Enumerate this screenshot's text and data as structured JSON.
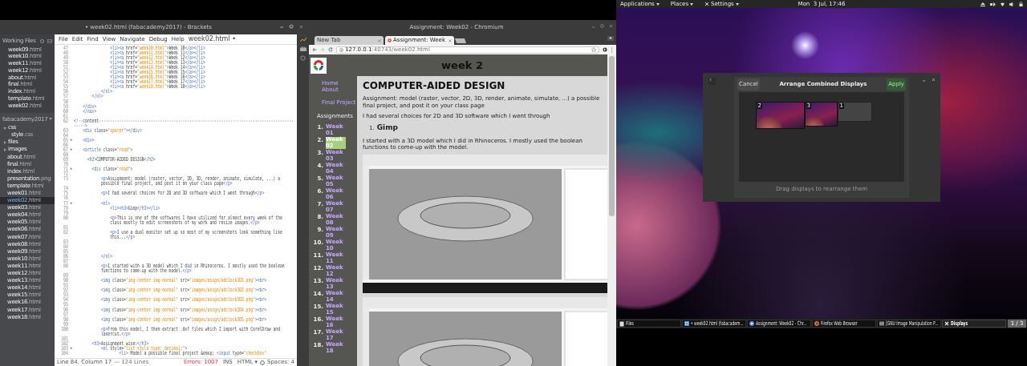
{
  "brackets": {
    "title": "• week02.html (fabacademy2017) - Brackets",
    "sidebar": {
      "working_files_title": "Working Files",
      "working_files": [
        {
          "name": "week09",
          "ext": ".html",
          "selected": false
        },
        {
          "name": "week10",
          "ext": ".html",
          "selected": false
        },
        {
          "name": "week11",
          "ext": ".html",
          "selected": false
        },
        {
          "name": "week12",
          "ext": ".html",
          "selected": false
        },
        {
          "name": "about",
          "ext": ".html",
          "selected": false
        },
        {
          "name": "final",
          "ext": ".html",
          "selected": false
        },
        {
          "name": "index",
          "ext": ".html",
          "selected": false
        },
        {
          "name": "template",
          "ext": ".html",
          "selected": false
        },
        {
          "name": "week02",
          "ext": ".html",
          "selected": false
        }
      ],
      "project": "fabacademy2017",
      "tree": [
        {
          "kind": "folder",
          "name": "css",
          "expanded": true,
          "selected": false,
          "children": [
            {
              "kind": "file",
              "name": "style",
              "ext": ".css",
              "selected": false
            }
          ]
        },
        {
          "kind": "folder",
          "name": "files",
          "expanded": false,
          "selected": false
        },
        {
          "kind": "folder",
          "name": "images",
          "expanded": false,
          "selected": false
        },
        {
          "kind": "file",
          "name": "about",
          "ext": ".html",
          "selected": false
        },
        {
          "kind": "file",
          "name": "final",
          "ext": ".html",
          "selected": false
        },
        {
          "kind": "file",
          "name": "index",
          "ext": ".html",
          "selected": false
        },
        {
          "kind": "file",
          "name": "presentation",
          "ext": ".png",
          "selected": false
        },
        {
          "kind": "file",
          "name": "template",
          "ext": ".html",
          "selected": false
        },
        {
          "kind": "file",
          "name": "week01",
          "ext": ".html",
          "selected": false
        },
        {
          "kind": "file",
          "name": "week02",
          "ext": ".html",
          "selected": true
        },
        {
          "kind": "file",
          "name": "week03",
          "ext": ".html",
          "selected": false
        },
        {
          "kind": "file",
          "name": "week04",
          "ext": ".html",
          "selected": false
        },
        {
          "kind": "file",
          "name": "week05",
          "ext": ".html",
          "selected": false
        },
        {
          "kind": "file",
          "name": "week06",
          "ext": ".html",
          "selected": false
        },
        {
          "kind": "file",
          "name": "week07",
          "ext": ".html",
          "selected": false
        },
        {
          "kind": "file",
          "name": "week08",
          "ext": ".html",
          "selected": false
        },
        {
          "kind": "file",
          "name": "week09",
          "ext": ".html",
          "selected": false
        },
        {
          "kind": "file",
          "name": "week10",
          "ext": ".html",
          "selected": false
        },
        {
          "kind": "file",
          "name": "week11",
          "ext": ".html",
          "selected": false
        },
        {
          "kind": "file",
          "name": "week12",
          "ext": ".html",
          "selected": false
        },
        {
          "kind": "file",
          "name": "week13",
          "ext": ".html",
          "selected": false
        },
        {
          "kind": "file",
          "name": "week14",
          "ext": ".html",
          "selected": false
        },
        {
          "kind": "file",
          "name": "week15",
          "ext": ".html",
          "selected": false
        },
        {
          "kind": "file",
          "name": "week16",
          "ext": ".html",
          "selected": false
        },
        {
          "kind": "file",
          "name": "week17",
          "ext": ".html",
          "selected": false
        },
        {
          "kind": "file",
          "name": "week18",
          "ext": ".html",
          "selected": false
        }
      ]
    },
    "menu": [
      "File",
      "Edit",
      "Find",
      "View",
      "Navigate",
      "Debug",
      "Help"
    ],
    "file_title": "week02.html •",
    "code": [
      {
        "num": "47",
        "text": "                <li><a href=\"week10.html\">Week 10</a></li>"
      },
      {
        "num": "48",
        "text": "                <li><a href=\"week11.html\">Week 11</a></li>"
      },
      {
        "num": "49",
        "text": "                <li><a href=\"week12.html\">Week 12</a></li>"
      },
      {
        "num": "50",
        "text": "                <li><a href=\"week13.html\">Week 13</a></li>"
      },
      {
        "num": "51",
        "text": "                <li><a href=\"week14.html\">Week 14</a></li>"
      },
      {
        "num": "52",
        "text": "                <li><a href=\"week15.html\">Week 15</a></li>"
      },
      {
        "num": "53",
        "text": "                <li><a href=\"week16.html\">Week 16</a></li>"
      },
      {
        "num": "54",
        "text": "                <li><a href=\"week17.html\">Week 17</a></li>"
      },
      {
        "num": "55",
        "text": "                <li><a href=\"week18.html\">Week 18</a></li>"
      },
      {
        "num": "56",
        "text": "            </ol>"
      },
      {
        "num": "57",
        "text": "        </ol>"
      },
      {
        "num": "58"
      },
      {
        "num": "59",
        "text": "    </div>"
      },
      {
        "num": "60",
        "text": "    </nav>"
      },
      {
        "num": "61"
      },
      {
        "num": "62",
        "text": "<!--content--------------------------------------------------------------------------------------",
        "cont": "----->"
      },
      {
        "num": "63",
        "text": "    <div class=\"spacer\"></div>"
      },
      {
        "num": "64"
      },
      {
        "num": "65",
        "text": "    <div>",
        "marker": "▾"
      },
      {
        "num": "66"
      },
      {
        "num": "67",
        "text": "    <article class=\"read\">",
        "marker": "▾"
      },
      {
        "num": "68"
      },
      {
        "num": "69",
        "text": "      <h2>COMPUTER-AIDED DESIGN</h2>"
      },
      {
        "num": "70"
      },
      {
        "num": "71",
        "text": "        <div class=\"read\">",
        "marker": "▾"
      },
      {
        "num": "72"
      },
      {
        "num": "73",
        "text": "            <p>Assignment: model (raster, vector, 2D, 3D, render, animate, simulate, ...) a",
        "cont": "            possible final project, and post it on your class page</p>"
      },
      {
        "num": "74"
      },
      {
        "num": "75",
        "text": "            <p>I had several choices for 2D and 3D software which I went through</p>"
      },
      {
        "num": "76"
      },
      {
        "num": "77",
        "text": "            <ol>",
        "marker": "▾"
      },
      {
        "num": "78",
        "text": "                <li><h3>Gimp</h3></li>"
      },
      {
        "num": "79"
      },
      {
        "num": "80",
        "text": "                <p>This is one of the softwares I have utilized for almost every week of the",
        "cont": "                class mostly to edit screenshots of my work and resize images.</p>"
      },
      {
        "num": "81"
      },
      {
        "num": "82",
        "text": "                <p>I use a dual monitor set up so most of my screenshots look something like",
        "cont": "                this...</p>"
      },
      {
        "num": "83"
      },
      {
        "num": "84"
      },
      {
        "num": "85"
      },
      {
        "num": "86",
        "text": "            </ol>"
      },
      {
        "num": "87"
      },
      {
        "num": "88",
        "text": "            <p>I started with a 3D model which I did in Rhinoceros. I mostly used the boolean",
        "cont": "            functions to come-up with the model.</p>"
      },
      {
        "num": "89"
      },
      {
        "num": "90",
        "text": "            <img class=\"img-center img-normal\" src=\"images/assgn/adclock3D1.png\"><br>"
      },
      {
        "num": "91"
      },
      {
        "num": "92",
        "text": "            <img class=\"img-center img-normal\" src=\"images/assgn/adclock3D2.png\"><br>"
      },
      {
        "num": "93"
      },
      {
        "num": "94",
        "text": "            <img class=\"img-center img-normal\" src=\"images/assgn/adclock3D3.png\"><br>"
      },
      {
        "num": "95"
      },
      {
        "num": "96",
        "text": "            <img class=\"img-center img-normal\" src=\"images/assgn/adclock3D4.png\"><br>"
      },
      {
        "num": "97"
      },
      {
        "num": "98",
        "text": "            <img class=\"img-center img-normal\" src=\"images/assgn/adclock3D5.png\"><br>"
      },
      {
        "num": "99"
      },
      {
        "num": "100",
        "text": "            <p>From this model, I then extract .dxf files which I import with CorelDraw and",
        "cont": "            lasercut.</p>"
      },
      {
        "num": "101"
      },
      {
        "num": "102",
        "text": "        <h3>Assignment wise:</h3>"
      },
      {
        "num": "103",
        "text": "            <ol style=\"list-style-type: decimal;\">",
        "marker": "▾"
      },
      {
        "num": "104",
        "text": "                    <li> Model a possible final project &emsp; <input type=\"checkbox\""
      }
    ],
    "status": {
      "position": "Line 84, Column 17",
      "line_count": "— 124 Lines",
      "errors": "Errors: 1007",
      "mode": "INS",
      "language": "HTML ▾",
      "indent": "Spaces: 4"
    }
  },
  "chromium": {
    "title": "Assignment: Week02 - Chromium",
    "tabs": [
      {
        "label": "New Tab",
        "selected": false
      },
      {
        "label": "Assignment: Week",
        "selected": true
      }
    ],
    "url_host": "127.0.0.1",
    "url_rest": ":40743/week02.html",
    "page": {
      "heading": "week 2",
      "nav_links": [
        "Home",
        "About",
        "Final Project"
      ],
      "assignments_label": "Assignments",
      "weeks": [
        {
          "number": "1.",
          "label": "Week 01",
          "selected": false
        },
        {
          "number": "2.",
          "label": "Week 02",
          "selected": true
        },
        {
          "number": "3.",
          "label": "Week 03",
          "selected": false
        },
        {
          "number": "4.",
          "label": "Week 04",
          "selected": false
        },
        {
          "number": "5.",
          "label": "Week 05",
          "selected": false
        },
        {
          "number": "6.",
          "label": "Week 06",
          "selected": false
        },
        {
          "number": "7.",
          "label": "Week 07",
          "selected": false
        },
        {
          "number": "8.",
          "label": "Week 08",
          "selected": false
        },
        {
          "number": "9.",
          "label": "Week 09",
          "selected": false
        },
        {
          "number": "10.",
          "label": "Week 10",
          "selected": false
        },
        {
          "number": "11.",
          "label": "Week 11",
          "selected": false
        },
        {
          "number": "12.",
          "label": "Week 12",
          "selected": false
        },
        {
          "number": "13.",
          "label": "Week 13",
          "selected": false
        },
        {
          "number": "14.",
          "label": "Week 14",
          "selected": false
        },
        {
          "number": "15.",
          "label": "Week 15",
          "selected": false
        },
        {
          "number": "16.",
          "label": "Week 16",
          "selected": false
        },
        {
          "number": "17.",
          "label": "Week 17",
          "selected": false
        },
        {
          "number": "18.",
          "label": "Week 18",
          "selected": false
        }
      ],
      "title": "COMPUTER-AIDED DESIGN",
      "blocks": [
        {
          "kind": "paragraph",
          "text": "Assignment: model (raster, vector, 2D, 3D, render, animate, simulate, ...) a possible final project, and post it on your class page"
        },
        {
          "kind": "paragraph",
          "text": "I had several choices for 2D and 3D software which I went through"
        },
        {
          "kind": "list-heading",
          "number": "1.",
          "text": "Gimp"
        },
        {
          "kind": "paragraph",
          "text": "I started with a 3D model which I did in Rhinoceros. I mostly used the boolean functions to come-up with the model."
        },
        {
          "kind": "image"
        },
        {
          "kind": "image"
        }
      ]
    }
  },
  "desktop": {
    "top_bar": {
      "menus": [
        "Applications",
        "Places",
        "Settings"
      ],
      "clock": "Mon  3 Jul, 17:46"
    },
    "dialog": {
      "cancel": "Cancel",
      "title": "Arrange Combined Displays",
      "apply": "Apply",
      "apply_disabled": true,
      "monitors": [
        {
          "label": "2",
          "kind": "wallpaper"
        },
        {
          "label": "3",
          "kind": "wallpaper"
        },
        {
          "label": "1",
          "kind": "blank"
        }
      ],
      "hint": "Drag displays to rearrange them"
    },
    "taskbar": {
      "items": [
        {
          "kind": "files",
          "label": "Files",
          "selected": false
        },
        {
          "kind": "editor",
          "label": "• week02.html (fabacadem...",
          "selected": false
        },
        {
          "kind": "chromium",
          "label": "Assignment: Week02 - Chr...",
          "selected": false
        },
        {
          "kind": "firefox",
          "label": "Firefox Web Browser",
          "selected": false
        },
        {
          "kind": "gimp",
          "label": "[GNU Image Manipulation P...",
          "selected": false
        },
        {
          "kind": "settings",
          "label": "Displays",
          "selected": true
        }
      ],
      "pager": "1 / 3"
    }
  }
}
